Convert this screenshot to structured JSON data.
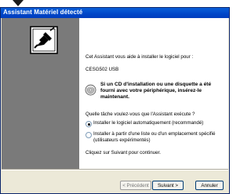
{
  "window": {
    "title": "Assistant Matériel détecté"
  },
  "content": {
    "intro": "Cet Assistant vous aide à installer le logiciel pour :",
    "device_name": "CESG502 USB",
    "cd_prompt": "Si un CD d'installation ou une disquette a été fourni avec votre périphérique, insérez-le maintenant.",
    "question": "Quelle tâche voulez-vous que l'Assistant exécute ?",
    "options": [
      {
        "label": "Installer le logiciel automatiquement (recommandé)",
        "checked": true
      },
      {
        "label": "Installer à partir d'une liste ou d'un emplacement spécifié (utilisateurs expérimentés)",
        "checked": false
      }
    ],
    "continue_hint": "Cliquez sur Suivant pour continuer."
  },
  "buttons": {
    "previous": "< Précédent",
    "next": "Suivant >",
    "cancel": "Annuler"
  },
  "colors": {
    "titlebar": "#0046c8",
    "left_panel": "#7a7a7a",
    "dialog_face": "#ece9d8"
  },
  "icons": {
    "wizard_graphic": "hardware-wizard-icon",
    "cd_icon": "cd-disk-icon",
    "pointer": "arrow-marker-icon"
  }
}
